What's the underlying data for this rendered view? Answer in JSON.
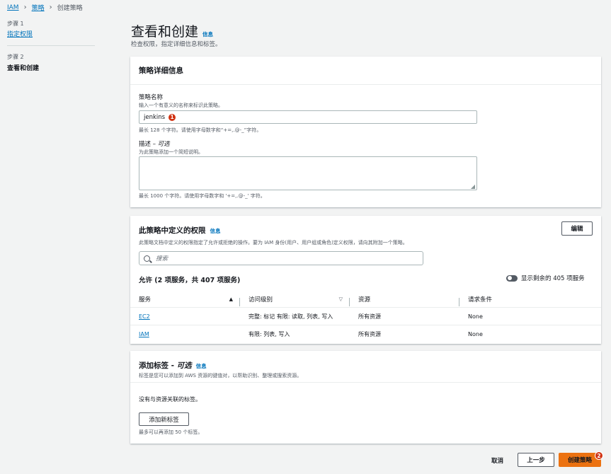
{
  "breadcrumb": {
    "root": "IAM",
    "parent": "策略",
    "current": "创建策略"
  },
  "steps": [
    {
      "label": "步骤 1",
      "title": "指定权限"
    },
    {
      "label": "步骤 2",
      "title": "查看和创建"
    }
  ],
  "page": {
    "title": "查看和创建",
    "info": "信息",
    "description": "检查权限，指定详细信息和标签。"
  },
  "details": {
    "title": "策略详细信息",
    "name_label": "策略名称",
    "name_hint": "输入一个有意义的名称来标识此策略。",
    "name_value": "jenkins",
    "name_badge": "1",
    "name_constraint": "最长 128 个字符。请使用字母数字和“+=,.@-_”字符。",
    "desc_label": "描述 –",
    "desc_optional": "可选",
    "desc_hint": "为此策略添加一个简短说明。",
    "desc_value": "",
    "desc_constraint": "最长 1000 个字符。请使用字母数字和 '+=,.@-_' 字符。"
  },
  "permissions": {
    "title": "此策略中定义的权限",
    "info": "信息",
    "edit_label": "编辑",
    "description": "此策略文档中定义的权限指定了允许或拒绝的操作。要为 IAM 身份(用户、用户组或角色)定义权限，请向其附加一个策略。",
    "search_placeholder": "搜索",
    "allow_summary": "允许 (2 项服务，共 407 项服务)",
    "toggle_label": "显示剩余的 405 项服务",
    "columns": [
      "服务",
      "访问级别",
      "资源",
      "请求条件"
    ],
    "rows": [
      {
        "service": "EC2",
        "access": "完整: 标记 有限: 读取, 列表, 写入",
        "resource": "所有资源",
        "condition": "None"
      },
      {
        "service": "IAM",
        "access": "有限: 列表, 写入",
        "resource": "所有资源",
        "condition": "None"
      }
    ]
  },
  "tags": {
    "title": "添加标签 -",
    "optional": "可选",
    "info": "信息",
    "description": "标签是您可以添加到 AWS 资源的键值对，以帮助识别、整理或搜索资源。",
    "empty": "没有与资源关联的标签。",
    "add_label": "添加新标签",
    "limit": "最多可以再添加 50 个标签。"
  },
  "footer": {
    "cancel": "取消",
    "previous": "上一步",
    "create": "创建策略",
    "create_badge": "2"
  },
  "colors": {
    "link": "#0073bb",
    "primary": "#ec7211",
    "badge": "#d13212"
  }
}
